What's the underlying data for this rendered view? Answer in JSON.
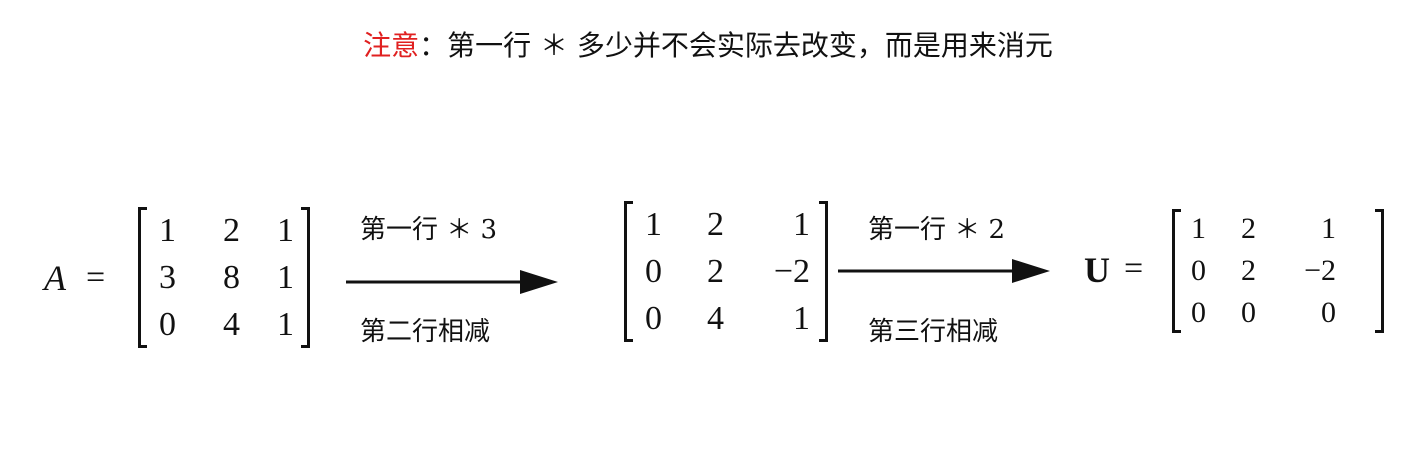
{
  "note": {
    "label": "注意",
    "colon": "：",
    "text": "第一行 ＊ 多少并不会实际去改变，而是用来消元"
  },
  "matrix_a": {
    "name": "A",
    "equals": "=",
    "rows": [
      [
        "1",
        "2",
        "1"
      ],
      [
        "3",
        "8",
        "1"
      ],
      [
        "0",
        "4",
        "1"
      ]
    ]
  },
  "step1": {
    "top": "第一行 ＊ 3",
    "bottom": "第二行相减"
  },
  "matrix_mid": {
    "rows": [
      [
        "1",
        "2",
        "1"
      ],
      [
        "0",
        "2",
        "−2"
      ],
      [
        "0",
        "4",
        "1"
      ]
    ]
  },
  "step2": {
    "top": "第一行 ＊ 2",
    "bottom": "第三行相减"
  },
  "matrix_u": {
    "name": "U",
    "equals": "=",
    "rows": [
      [
        "1",
        "2",
        "1"
      ],
      [
        "0",
        "2",
        "−2"
      ],
      [
        "0",
        "0",
        "0"
      ]
    ]
  },
  "colors": {
    "accent": "#e02020",
    "ink": "#111111"
  }
}
